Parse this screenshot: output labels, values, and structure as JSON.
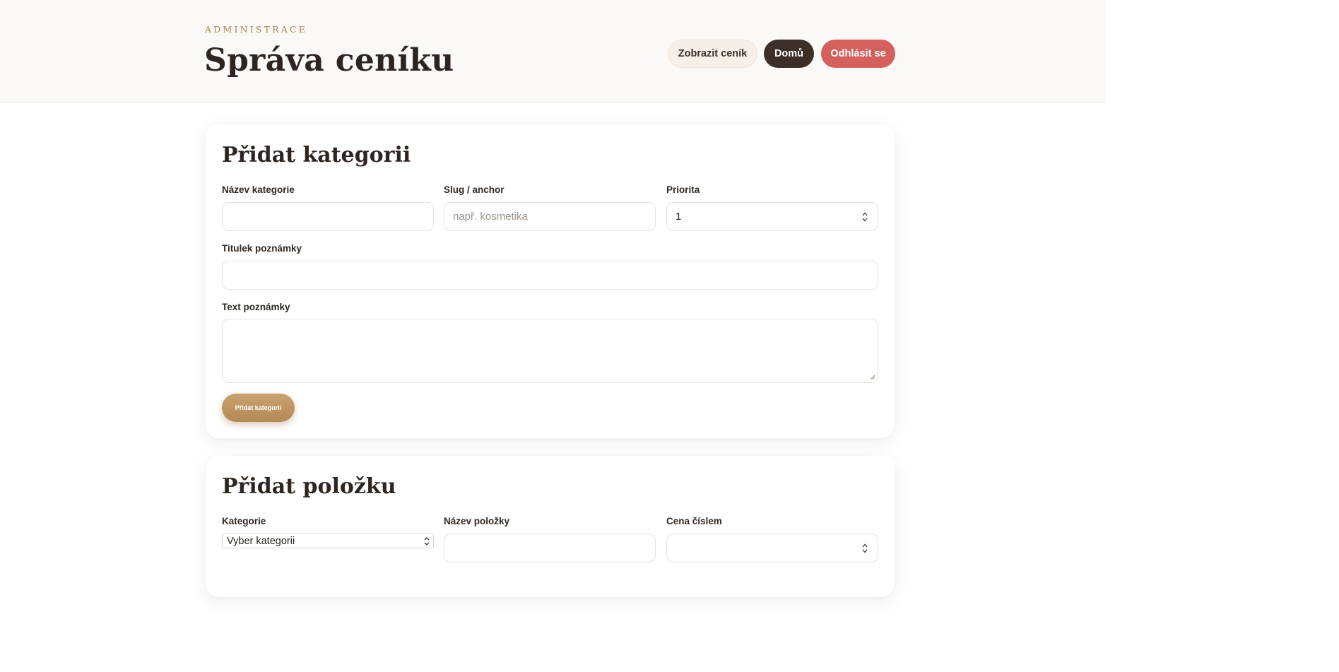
{
  "header": {
    "eyebrow": "ADMINISTRACE",
    "title": "Správa ceníku",
    "nav": {
      "view_label": "Zobrazit ceník",
      "home_label": "Domů",
      "logout_label": "Odhlásit se"
    }
  },
  "add_category": {
    "title": "Přidat kategorii",
    "name_label": "Název kategorie",
    "name_value": "",
    "slug_label": "Slug / anchor",
    "slug_placeholder": "např. kosmetika",
    "priority_label": "Priorita",
    "priority_value": "1",
    "note_title_label": "Titulek poznámky",
    "note_title_value": "",
    "note_text_label": "Text poznámky",
    "note_text_value": "",
    "submit_label": "Přidat kategorii"
  },
  "add_item": {
    "title": "Přidat položku",
    "category_label": "Kategorie",
    "category_selected": "Vyber kategorii",
    "name_label": "Název položky",
    "price_label": "Cena číslem"
  },
  "colors": {
    "accent_gold": "#b38a55",
    "dark": "#3b2f28",
    "danger": "#d5615f"
  }
}
